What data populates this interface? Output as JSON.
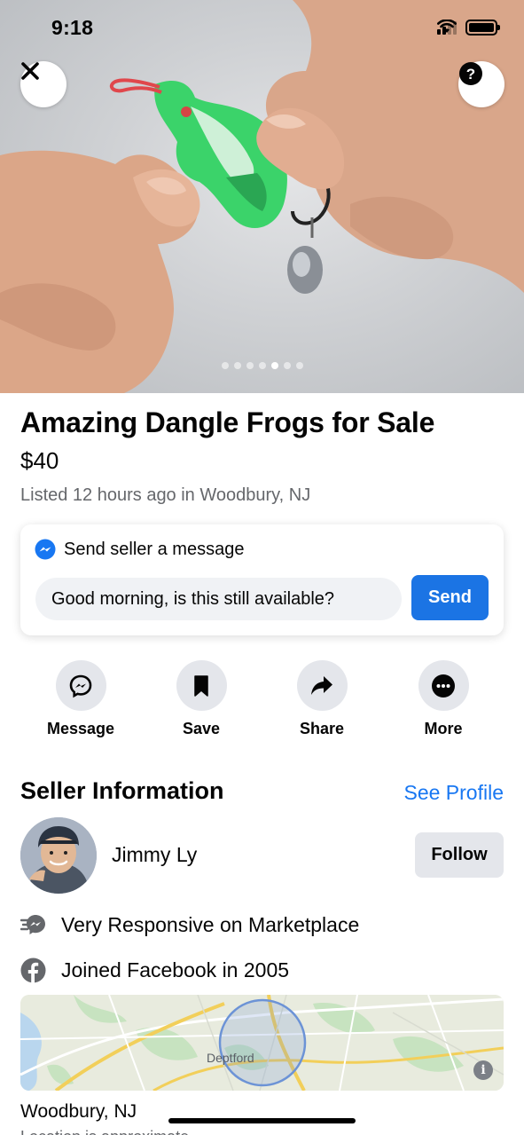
{
  "status_bar": {
    "time": "9:18"
  },
  "hero": {
    "photo_count": 7,
    "active_photo": 5
  },
  "listing": {
    "title": "Amazing Dangle Frogs for Sale",
    "price": "$40",
    "listed": "Listed 12 hours ago in Woodbury, NJ"
  },
  "message_card": {
    "heading": "Send seller a message",
    "input_value": "Good morning, is this still available?",
    "send_label": "Send"
  },
  "actions": [
    {
      "label": "Message",
      "icon": "messenger-icon"
    },
    {
      "label": "Save",
      "icon": "bookmark-icon"
    },
    {
      "label": "Share",
      "icon": "share-arrow-icon"
    },
    {
      "label": "More",
      "icon": "more-dots-icon"
    }
  ],
  "seller": {
    "heading": "Seller Information",
    "see_profile": "See Profile",
    "name": "Jimmy Ly",
    "follow_label": "Follow",
    "responsive": "Very Responsive on Marketplace",
    "joined": "Joined Facebook in 2005"
  },
  "map": {
    "place_label": "Deptford"
  },
  "location": {
    "title": "Woodbury, NJ",
    "subtitle": "Location is approximate"
  },
  "colors": {
    "accent": "#1877f2",
    "button_blue": "#1b74e4",
    "secondary_text": "#65676b",
    "chip_bg": "#e4e6eb"
  }
}
